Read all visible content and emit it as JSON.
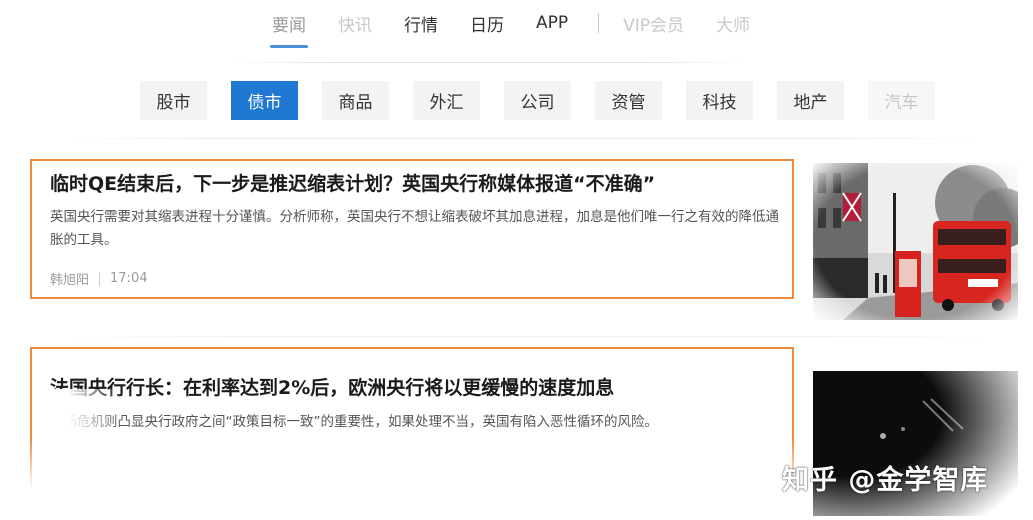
{
  "topnav": {
    "items": [
      {
        "label": "要闻",
        "state": "active-faded"
      },
      {
        "label": "快讯",
        "state": "faded"
      },
      {
        "label": "行情",
        "state": "normal"
      },
      {
        "label": "日历",
        "state": "normal"
      },
      {
        "label": "APP",
        "state": "normal"
      },
      {
        "label": "VIP会员",
        "state": "faded"
      },
      {
        "label": "大师",
        "state": "faded"
      }
    ]
  },
  "categories": [
    {
      "label": "股市"
    },
    {
      "label": "债市",
      "active": true
    },
    {
      "label": "商品"
    },
    {
      "label": "外汇"
    },
    {
      "label": "公司"
    },
    {
      "label": "资管"
    },
    {
      "label": "科技"
    },
    {
      "label": "地产"
    },
    {
      "label": "汽车"
    }
  ],
  "articles": [
    {
      "headline": "临时QE结束后，下一步是推迟缩表计划？英国央行称媒体报道“不准确”",
      "summary": "英国央行需要对其缩表进程十分谨慎。分析师称，英国央行不想让缩表破坏其加息进程，加息是他们唯一行之有效的降低通胀的工具。",
      "author": "韩旭阳",
      "time": "17:04"
    },
    {
      "headline": "法国央行行长：在利率达到2%后，欧洲央行将以更缓慢的速度加息",
      "summary": "这场危机则凸显央行政府之间“政策目标一致”的重要性，如果处理不当，英国有陷入恶性循环的风险。"
    }
  ],
  "watermark": "知乎 @金学智库",
  "colors": {
    "accent": "#1f78d1",
    "highlight_border": "#ee8a3c",
    "tab_bg": "#f2f3f5"
  }
}
